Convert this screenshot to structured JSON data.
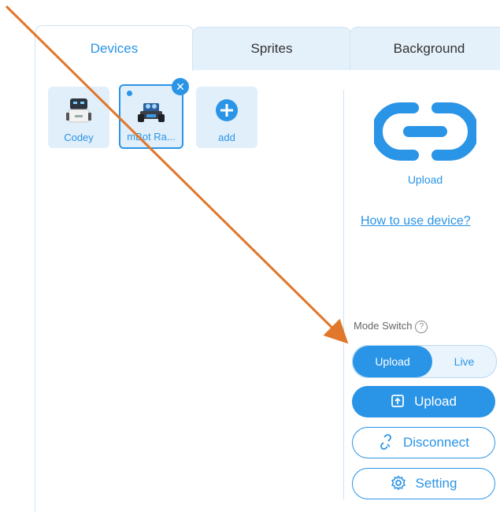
{
  "tabs": [
    {
      "label": "Devices",
      "active": true
    },
    {
      "label": "Sprites",
      "active": false
    },
    {
      "label": "Background",
      "active": false
    }
  ],
  "devices": [
    {
      "label": "Codey",
      "icon": "codey-robot-icon"
    },
    {
      "label": "mBot Ra...",
      "icon": "mbot-ranger-icon",
      "selected": true
    },
    {
      "label": "add",
      "icon": "add-icon"
    }
  ],
  "side": {
    "connection_icon": "link-icon",
    "caption": "Upload",
    "help_link": "How to use device?",
    "mode_switch_label": "Mode Switch",
    "mode_options": [
      {
        "label": "Upload",
        "active": true
      },
      {
        "label": "Live",
        "active": false
      }
    ],
    "buttons": {
      "upload": "Upload",
      "disconnect": "Disconnect",
      "setting": "Setting"
    }
  },
  "colors": {
    "accent": "#2a94e6",
    "tab_bg": "#e4f1fb",
    "annotation_arrow": "#e0772b"
  }
}
